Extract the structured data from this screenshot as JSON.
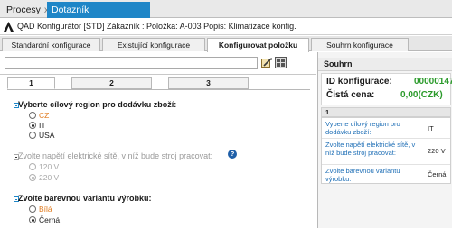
{
  "app_tabs": [
    {
      "label": "Procesy",
      "close": "x"
    },
    {
      "label": "Dotazník konfigurace",
      "close": "x"
    }
  ],
  "titlebar": {
    "title": "QAD Konfigurátor [STD] Zákazník : Položka: A-003 Popis: Klimatizace konfig."
  },
  "subtabs": [
    {
      "label": "Standardní konfigurace"
    },
    {
      "label": "Existující konfigurace"
    },
    {
      "label": "Konfigurovat položku"
    },
    {
      "label": "Souhrn konfigurace"
    }
  ],
  "search": {
    "value": "",
    "placeholder": ""
  },
  "steps": [
    "1",
    "2",
    "3"
  ],
  "questions": [
    {
      "text": "Vyberte cílový region pro dodávku zboží:",
      "options": [
        {
          "label": "CZ",
          "selected": false
        },
        {
          "label": "IT",
          "selected": true
        },
        {
          "label": "USA",
          "selected": false
        }
      ]
    },
    {
      "text": "Zvolte napětí elektrické sítě, v níž bude stroj pracovat:",
      "disabled": true,
      "options": [
        {
          "label": "120 V",
          "selected": false
        },
        {
          "label": "220 V",
          "selected": true
        }
      ]
    },
    {
      "text": "Zvolte barevnou variantu výrobku:",
      "options": [
        {
          "label": "Bílá",
          "selected": false
        },
        {
          "label": "Černá",
          "selected": true
        }
      ]
    }
  ],
  "summary": {
    "header": "Souhrn",
    "id_label": "ID konfigurace:",
    "id_value": "00000147",
    "price_label": "Čistá cena:",
    "price_value": "0,00(CZK)",
    "group": "1",
    "items": [
      {
        "question": "Vyberte cílový region pro dodávku zboží:",
        "answer": "IT"
      },
      {
        "question": "Zvolte napětí elektrické sítě, v níž bude stroj pracovat:",
        "answer": "220 V"
      },
      {
        "question": "Zvolte barevnou variantu výrobku:",
        "answer": "Černá"
      }
    ]
  },
  "colors": {
    "accent": "#1f86c7",
    "highlight": "#e07b1f",
    "success": "#2a9a2a",
    "link": "#1f6fb6"
  }
}
